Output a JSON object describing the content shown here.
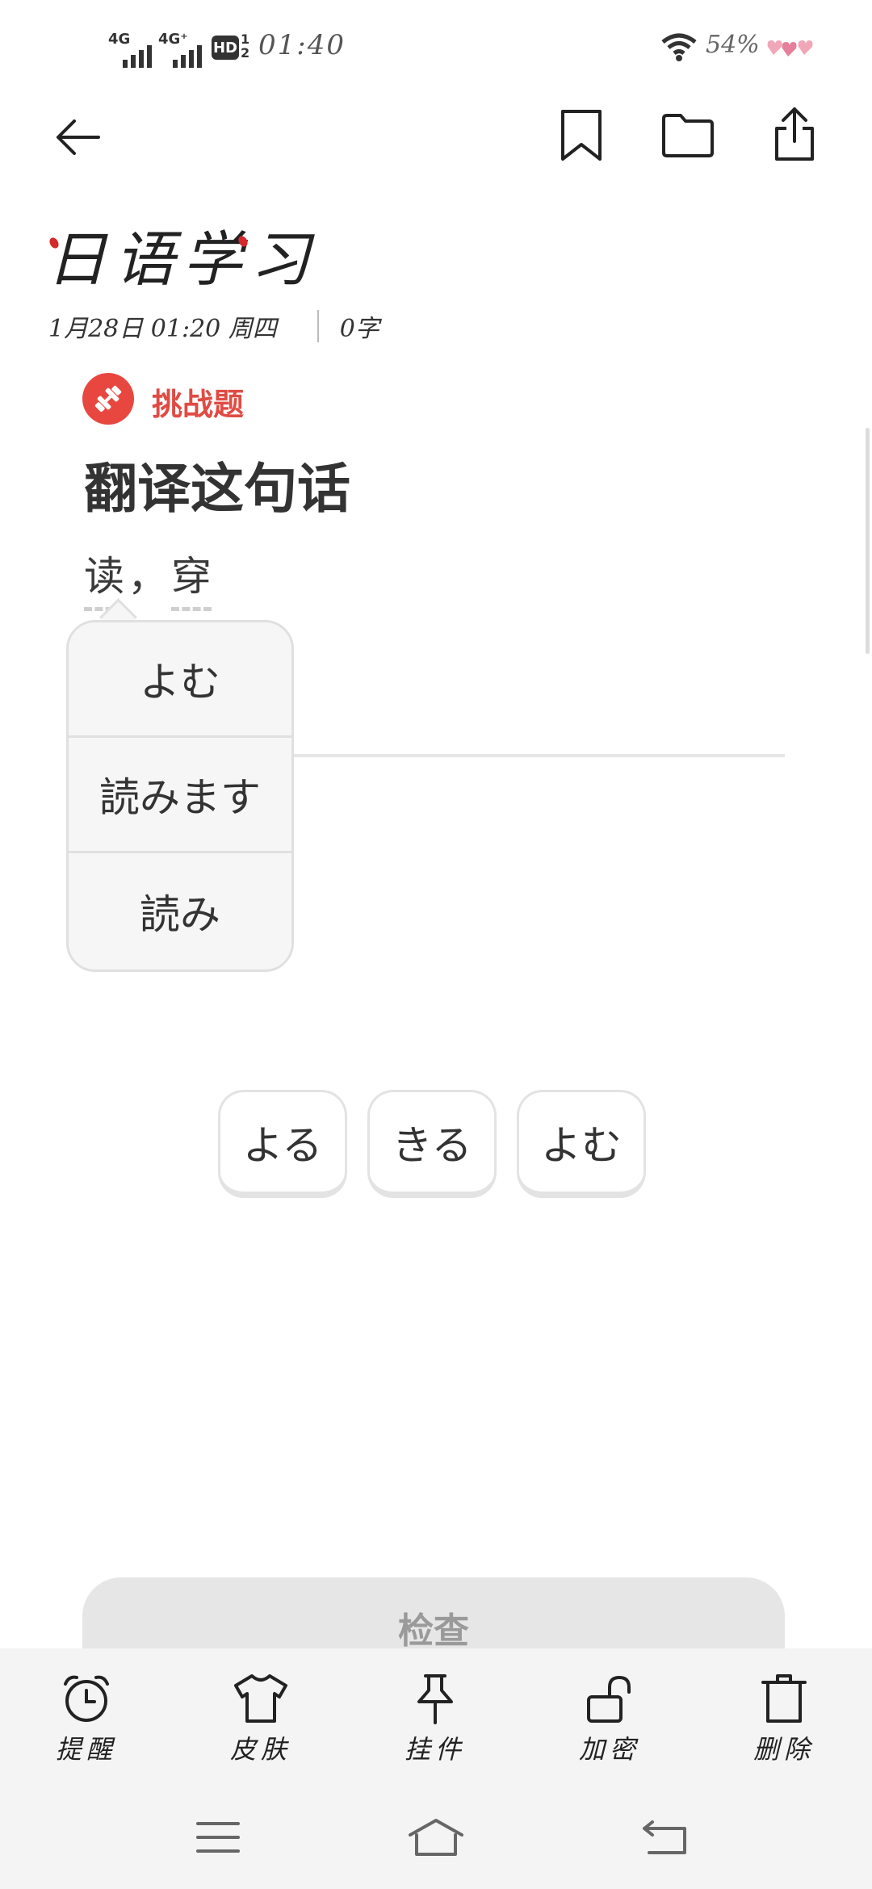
{
  "status_bar": {
    "signal1_label": "4G",
    "signal2_label": "4G⁺",
    "hd_label": "HD",
    "hd_sub": "1\n2",
    "time": "01:40",
    "battery": "54%"
  },
  "note": {
    "title": "日语学习",
    "date": "1月28日 01:20 周四",
    "word_count": "0字"
  },
  "challenge": {
    "badge_label": "挑战题",
    "question": "翻译这句话",
    "words": [
      "读",
      "穿"
    ],
    "separator": "，"
  },
  "popup": {
    "options": [
      "よむ",
      "読みます",
      "読み"
    ]
  },
  "chips": [
    "よる",
    "きる",
    "よむ"
  ],
  "check_button": {
    "label": "检查"
  },
  "toolbar": {
    "items": [
      {
        "label": "提醒",
        "icon": "alarm-clock-icon"
      },
      {
        "label": "皮肤",
        "icon": "shirt-icon"
      },
      {
        "label": "挂件",
        "icon": "pushpin-icon"
      },
      {
        "label": "加密",
        "icon": "unlock-icon"
      },
      {
        "label": "删除",
        "icon": "trash-icon"
      }
    ]
  },
  "colors": {
    "accent_red": "#e8473f",
    "badge_text": "#e04b44"
  }
}
